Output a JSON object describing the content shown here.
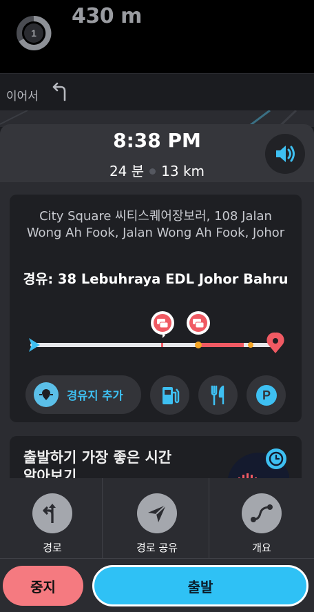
{
  "instruction": {
    "exit_number": "1",
    "distance": "430 m"
  },
  "then": {
    "label": "이어서"
  },
  "header": {
    "eta": "8:38 PM",
    "duration": "24 분",
    "distance": "13 km"
  },
  "destination": {
    "address": "City Square 씨티스퀘어장보러, 108 Jalan Wong Ah Fook, Jalan Wong Ah Fook, Johor",
    "via": "경유: 38 Lebuhraya EDL Johor Bahru"
  },
  "actions": {
    "add_stop_label": "경유지 추가",
    "parking_letter": "P"
  },
  "best_time": {
    "title": "출발하기 가장 좋은 시간 알아보기"
  },
  "bottom_nav": {
    "items": [
      {
        "label": "경로",
        "icon": "route-icon"
      },
      {
        "label": "경로 공유",
        "icon": "share-route-icon"
      },
      {
        "label": "개요",
        "icon": "overview-icon"
      }
    ],
    "stop_label": "중지",
    "go_label": "출발"
  },
  "colors": {
    "accent_blue": "#2fc1f5",
    "stop_red": "#f57a80",
    "traffic_red": "#f05a63",
    "traffic_orange": "#f5a524"
  }
}
